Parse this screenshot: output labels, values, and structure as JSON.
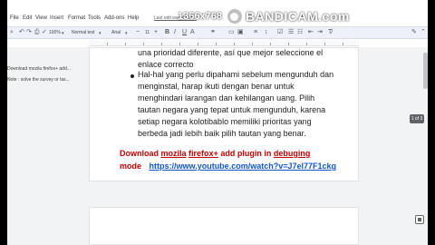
{
  "menu": {
    "items": [
      "File",
      "Edit",
      "View",
      "Insert",
      "Format",
      "Tools",
      "Add-ons",
      "Help"
    ],
    "saved_text": "Last edit was 4 min..."
  },
  "watermark": {
    "resolution": "1366x768",
    "brand": "BANDICAM",
    "domain": ".com"
  },
  "toolbar": {
    "zoom": "100%",
    "style": "Normal text",
    "font": "Arial",
    "size": "11"
  },
  "outline": {
    "items": [
      "Download mozila firefox+ add...",
      "Note : solve the survey or las..."
    ]
  },
  "document": {
    "partial_line1": "una prioridad diferente, así que mejor seleccione el",
    "partial_line2": "enlace correcto",
    "bullet_lines": [
      "Hal-hal yang perlu dipahami sebelum mengunduh dan",
      "menginstal, harap ikuti dengan benar untuk",
      "menghindari larangan dan kehilangan uang. Pilih",
      "tautan negara yang tepat untuk mengunduh, karena",
      "setiap negara kolotibablo memiliki prioritas yang",
      "berbeda jadi lebih baik pilih tautan yang benar."
    ],
    "download": {
      "w1": "Download",
      "w2": "mozila",
      "w3": "firefox+",
      "w4": "add plugin in",
      "w5": "debuging",
      "w6": "mode",
      "link": "https://www.youtube.com/watch?v=J7el77F1ckg"
    }
  },
  "page_indicator": "1 of 3"
}
